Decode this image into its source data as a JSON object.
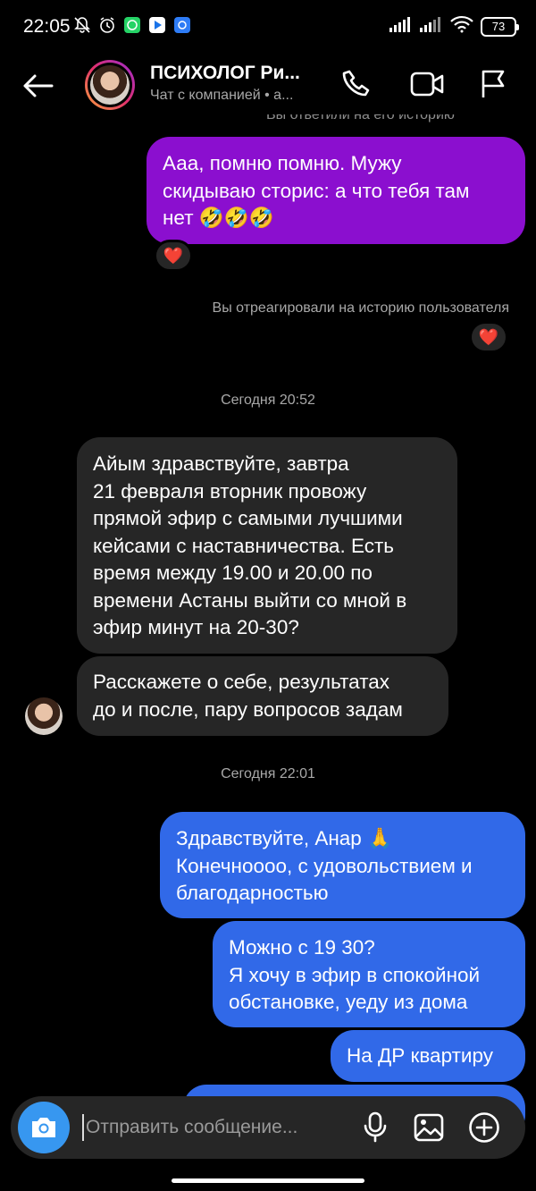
{
  "status_bar": {
    "time": "22:05",
    "battery": "73"
  },
  "header": {
    "contact_name": "ПСИХОЛОГ Ри...",
    "subtitle": "Чат с компанией • а..."
  },
  "messages": {
    "cut_text": "Вы ответили на его историю",
    "msg1": {
      "lines": [
        "Ааа, помню помню. Мужу",
        "скидываю сторис: а что тебя там",
        "нет 🤣🤣🤣"
      ],
      "reaction": "❤️"
    },
    "story_notice": "Вы отреагировали на историю пользователя",
    "story_reaction": "❤️",
    "timestamp1": "Сегодня 20:52",
    "msg2": {
      "lines": [
        "Айым здравствуйте, завтра",
        "21 февраля вторник провожу",
        "прямой эфир с самыми лучшими",
        "кейсами с наставничества. Есть",
        "время между 19.00 и 20.00 по",
        "времени Астаны выйти со мной в",
        "эфир минут на 20-30?"
      ]
    },
    "msg3": {
      "lines": [
        "Расскажете о себе, результатах",
        "до и после, пару вопросов задам"
      ]
    },
    "timestamp2": "Сегодня 22:01",
    "msg4": {
      "lines": [
        "Здравствуйте, Анар 🙏",
        "Конечнoooo, с удовольствием и",
        "благодарностью"
      ]
    },
    "msg5": {
      "lines": [
        "Можно с 19 30?",
        "Я хочу в эфир в спокойной",
        "обстановке, уеду из дома"
      ]
    },
    "msg6": {
      "lines": [
        "На ДР квартиру"
      ]
    }
  },
  "composer": {
    "placeholder": "Отправить сообщение..."
  },
  "icons": {
    "back": "arrow-left-icon",
    "call": "phone-icon",
    "video": "video-camera-icon",
    "report": "flag-icon",
    "camera": "camera-icon",
    "mic": "microphone-icon",
    "gallery": "image-icon",
    "add": "plus-circle-icon"
  },
  "colors": {
    "sent_purple": "#8b0fcf",
    "sent_blue": "#3169e8",
    "received": "#262626",
    "camera_button": "#3797f0"
  }
}
